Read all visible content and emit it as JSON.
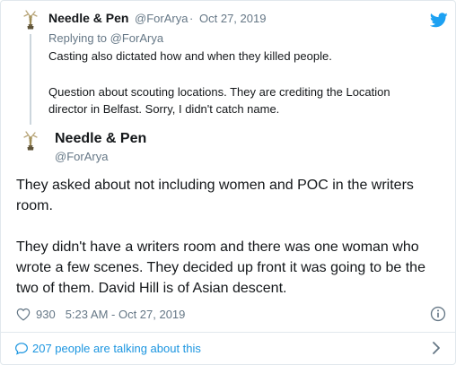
{
  "parent_tweet": {
    "author_name": "Needle & Pen",
    "author_handle": "@ForArya",
    "separator": "·",
    "date": "Oct 27, 2019",
    "replying_prefix": "Replying to",
    "replying_to": "@ForArya",
    "text_lines": [
      "Casting also dictated how and when they killed people.",
      "",
      "Question about scouting locations. They are crediting the Location",
      "director in Belfast. Sorry, I didn't catch name."
    ]
  },
  "main_tweet": {
    "author_name": "Needle & Pen",
    "author_handle": "@ForArya",
    "text_lines": [
      "They asked about not including women and POC in the writers",
      "room.",
      "",
      "They didn't have a writers room and there was one woman who",
      "wrote a few scenes. They decided up front it was going to be the",
      "two of them. David Hill is of Asian descent."
    ],
    "likes": "930",
    "timestamp": "5:23 AM - Oct 27, 2019"
  },
  "footer": {
    "talking_label": "207 people are talking about this"
  },
  "icons": {
    "avatar": "emmy-statuette-icon",
    "brand": "twitter-bird-icon",
    "like": "heart-icon",
    "info": "info-icon",
    "conversation": "speech-bubble-icon",
    "expand": "chevron-right-icon"
  },
  "colors": {
    "text": "#14171a",
    "muted": "#657786",
    "link": "#1b95e0",
    "twitter_blue": "#1da1f2",
    "border": "#e1e8ed",
    "thread_line": "#ccd6dd"
  }
}
